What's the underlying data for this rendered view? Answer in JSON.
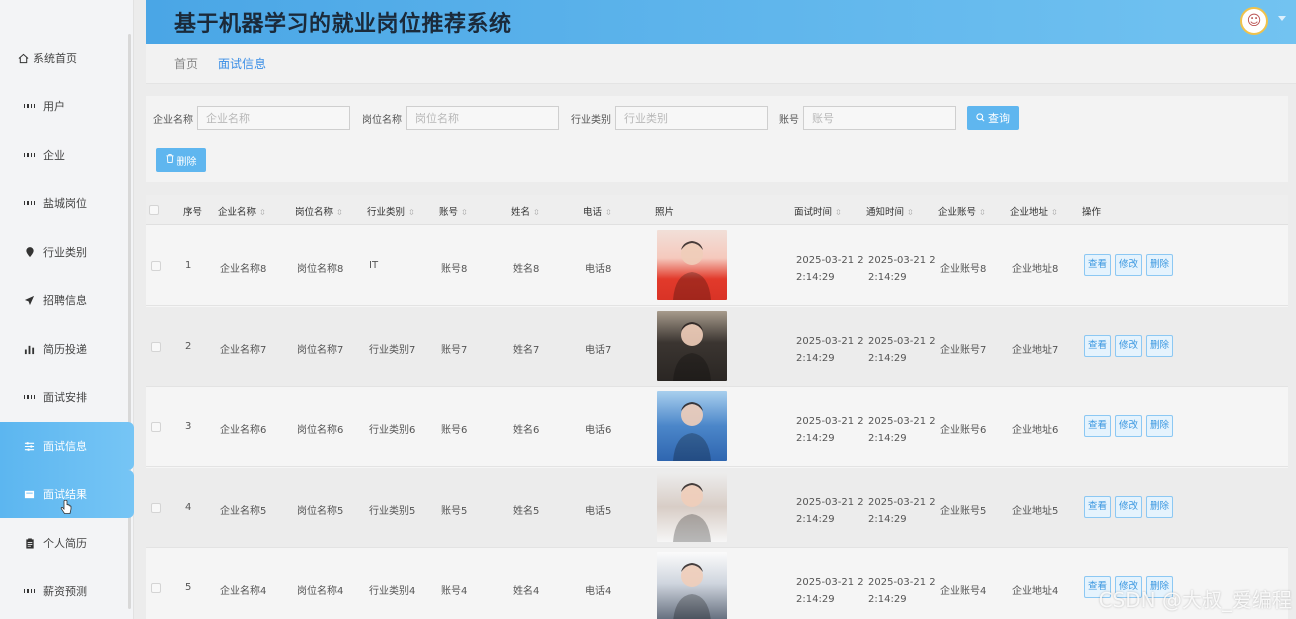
{
  "app": {
    "title": "基于机器学习的就业岗位推荐系统"
  },
  "sidebar": {
    "items": [
      {
        "label": "系统首页",
        "icon": "home-icon"
      },
      {
        "label": "用户",
        "icon": "grid-icon"
      },
      {
        "label": "企业",
        "icon": "grid-icon"
      },
      {
        "label": "盐城岗位",
        "icon": "grid-icon"
      },
      {
        "label": "行业类别",
        "icon": "pin-icon"
      },
      {
        "label": "招聘信息",
        "icon": "send-icon"
      },
      {
        "label": "简历投递",
        "icon": "bar-chart-icon"
      },
      {
        "label": "面试安排",
        "icon": "grid-icon"
      },
      {
        "label": "面试信息",
        "icon": "sliders-icon"
      },
      {
        "label": "面试结果",
        "icon": "card-icon"
      },
      {
        "label": "个人简历",
        "icon": "clipboard-icon"
      },
      {
        "label": "薪资预测",
        "icon": "grid-icon"
      }
    ]
  },
  "breadcrumb": {
    "home": "首页",
    "current": "面试信息"
  },
  "search": {
    "company_label": "企业名称",
    "company_placeholder": "企业名称",
    "position_label": "岗位名称",
    "position_placeholder": "岗位名称",
    "industry_label": "行业类别",
    "industry_placeholder": "行业类别",
    "account_label": "账号",
    "account_placeholder": "账号",
    "query_label": "查询",
    "delete_label": "删除"
  },
  "table": {
    "headers": {
      "index": "序号",
      "company": "企业名称",
      "position": "岗位名称",
      "industry": "行业类别",
      "account": "账号",
      "name": "姓名",
      "phone": "电话",
      "photo": "照片",
      "interview_time": "面试时间",
      "notify_time": "通知时间",
      "company_account": "企业账号",
      "company_address": "企业地址",
      "actions": "操作"
    },
    "action_labels": {
      "view": "查看",
      "edit": "修改",
      "delete": "删除"
    },
    "rows": [
      {
        "index": "1",
        "company": "企业名称8",
        "position": "岗位名称8",
        "industry": "IT",
        "account": "账号8",
        "name": "姓名8",
        "phone": "电话8",
        "interview_time": "2025-03-21 2 2:14:29",
        "notify_time": "2025-03-21 2 2:14:29",
        "company_account": "企业账号8",
        "company_address": "企业地址8"
      },
      {
        "index": "2",
        "company": "企业名称7",
        "position": "岗位名称7",
        "industry": "行业类别7",
        "account": "账号7",
        "name": "姓名7",
        "phone": "电话7",
        "interview_time": "2025-03-21 2 2:14:29",
        "notify_time": "2025-03-21 2 2:14:29",
        "company_account": "企业账号7",
        "company_address": "企业地址7"
      },
      {
        "index": "3",
        "company": "企业名称6",
        "position": "岗位名称6",
        "industry": "行业类别6",
        "account": "账号6",
        "name": "姓名6",
        "phone": "电话6",
        "interview_time": "2025-03-21 2 2:14:29",
        "notify_time": "2025-03-21 2 2:14:29",
        "company_account": "企业账号6",
        "company_address": "企业地址6"
      },
      {
        "index": "4",
        "company": "企业名称5",
        "position": "岗位名称5",
        "industry": "行业类别5",
        "account": "账号5",
        "name": "姓名5",
        "phone": "电话5",
        "interview_time": "2025-03-21 2 2:14:29",
        "notify_time": "2025-03-21 2 2:14:29",
        "company_account": "企业账号5",
        "company_address": "企业地址5"
      },
      {
        "index": "5",
        "company": "企业名称4",
        "position": "岗位名称4",
        "industry": "行业类别4",
        "account": "账号4",
        "name": "姓名4",
        "phone": "电话4",
        "interview_time": "2025-03-21 2 2:14:29",
        "notify_time": "2025-03-21 2 2:14:29",
        "company_account": "企业账号4",
        "company_address": "企业地址4"
      }
    ]
  },
  "watermark": "CSDN @大叔_爱编程",
  "colors": {
    "accent": "#5fb6ef",
    "header_start": "#4aa6e6",
    "header_end": "#72c3f1",
    "active_nav": "#5cb6f0"
  }
}
